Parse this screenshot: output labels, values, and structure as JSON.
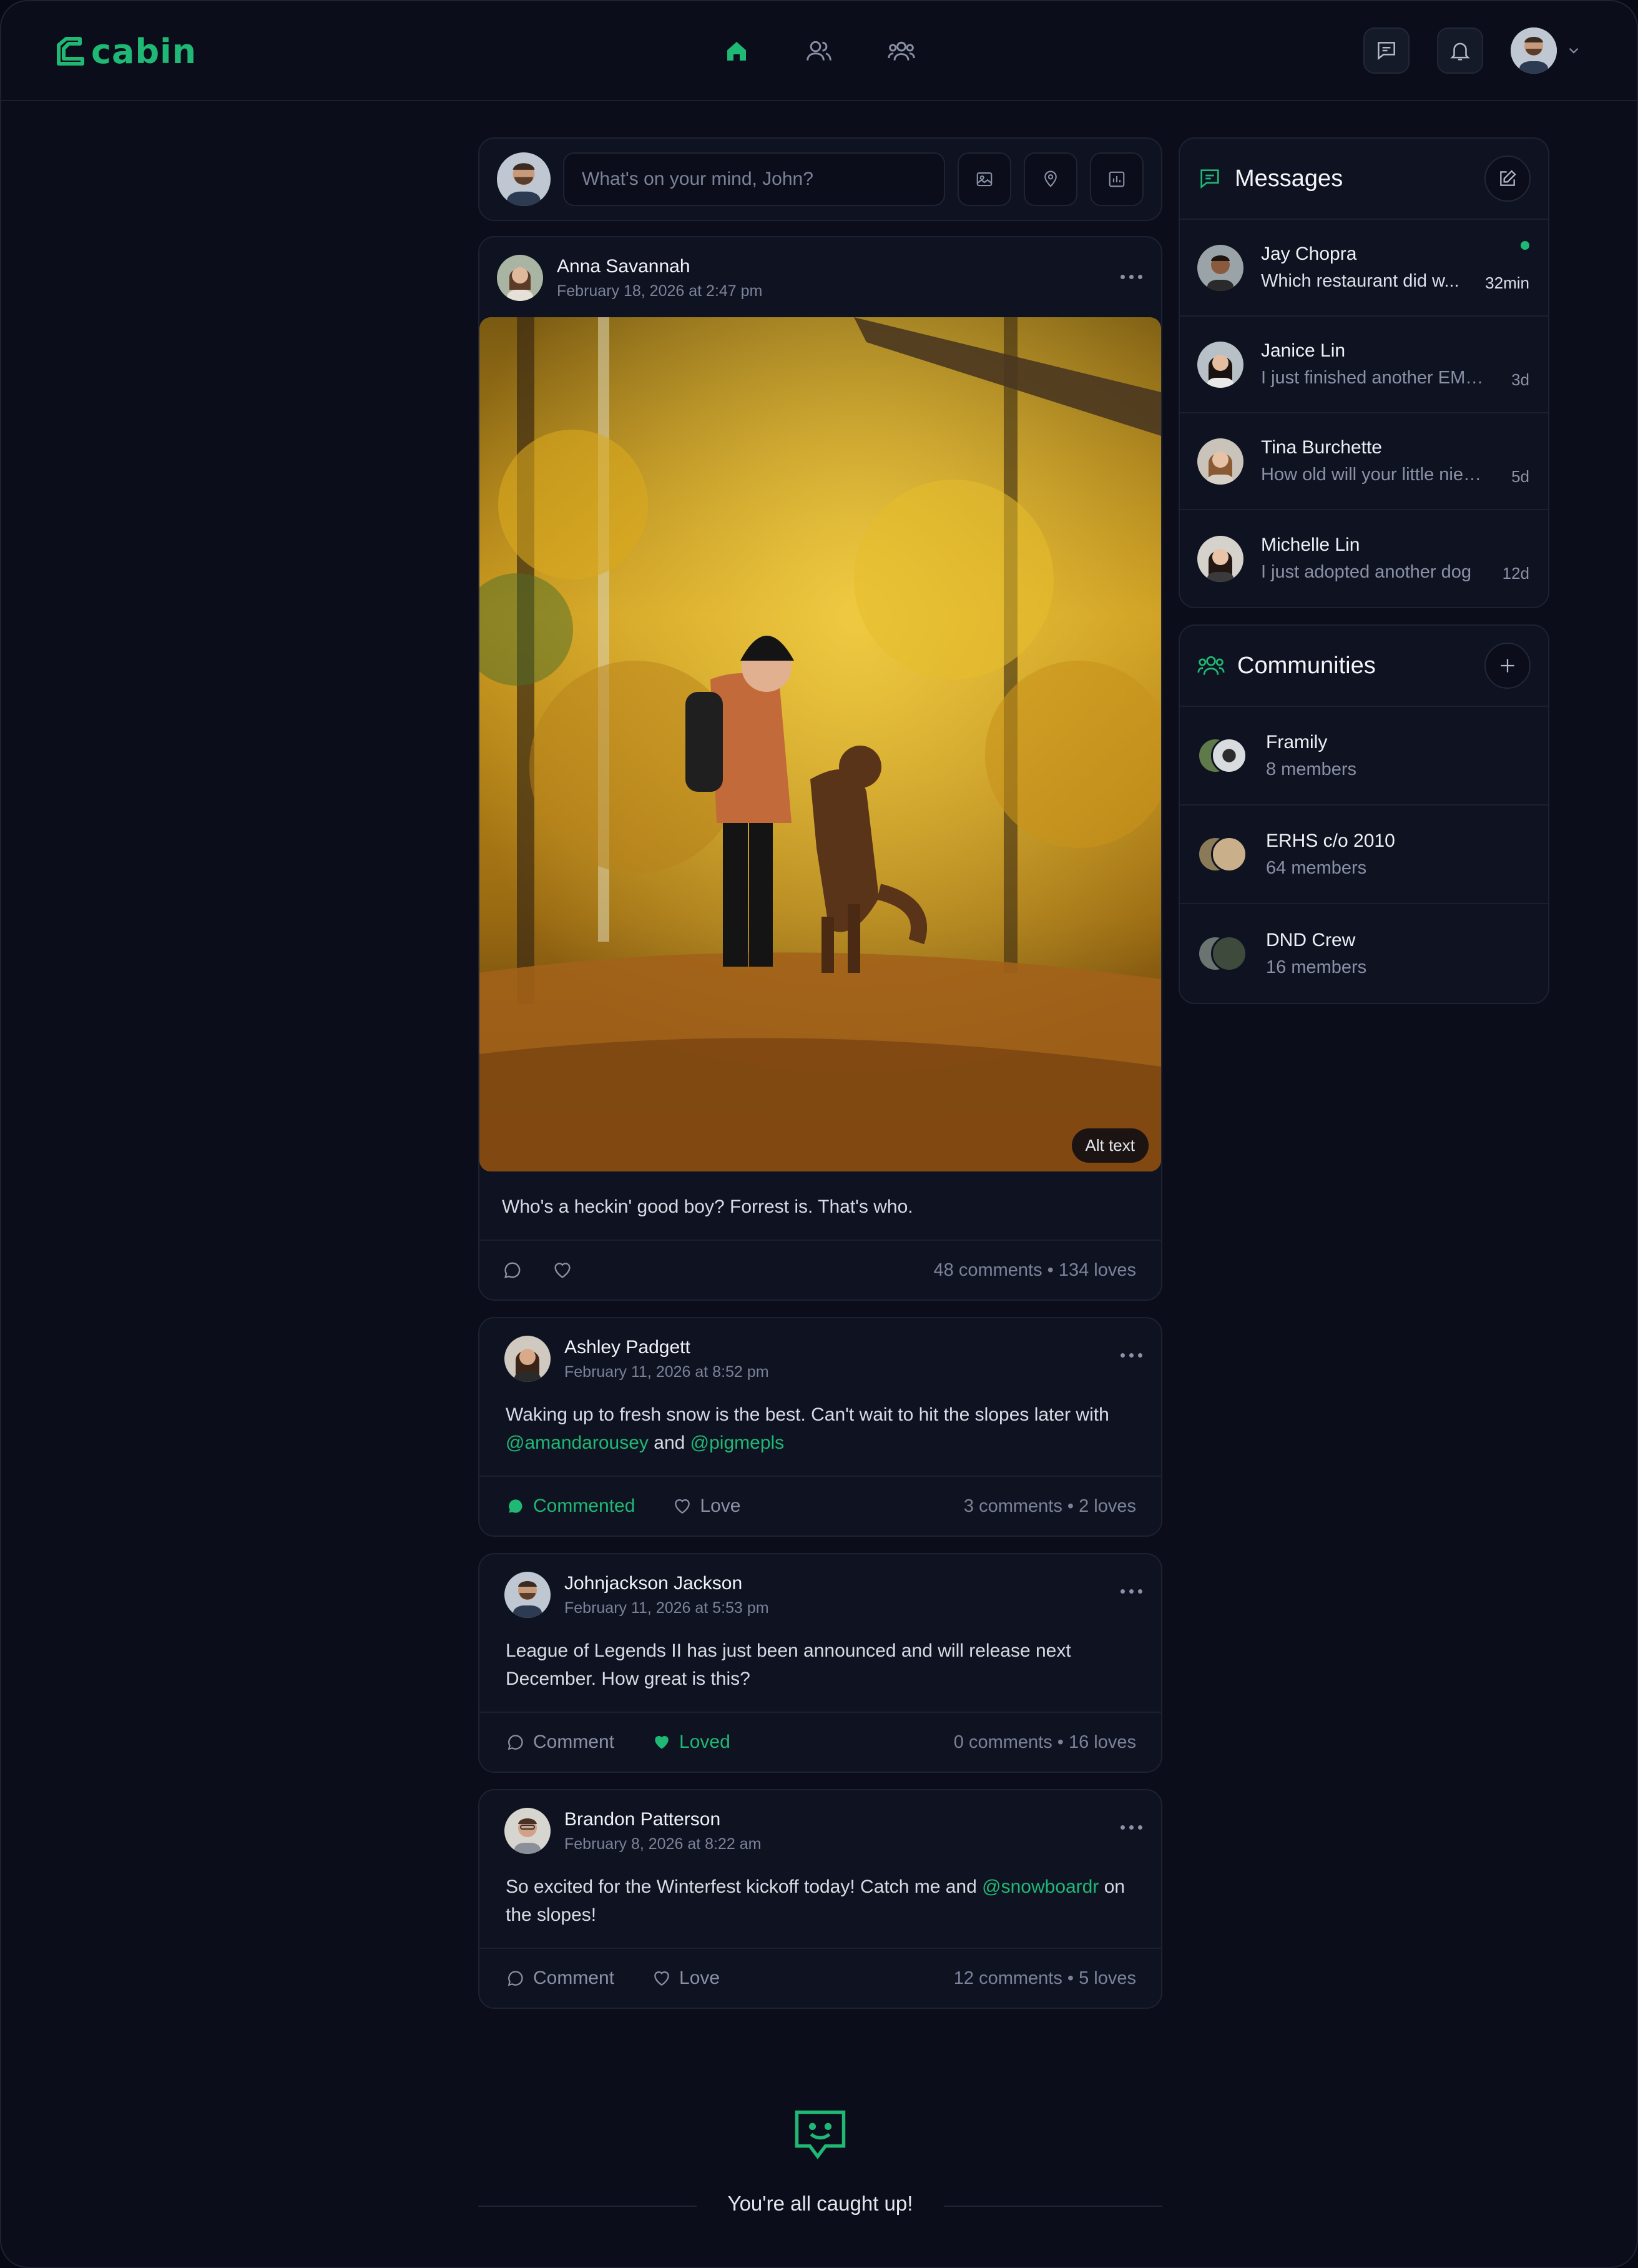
{
  "app": {
    "name": "cabin"
  },
  "composer": {
    "placeholder": "What's on your mind, John?"
  },
  "posts": [
    {
      "author": "Anna Savannah",
      "date": "February 18, 2026 at 2:47 pm",
      "alt_label": "Alt text",
      "text": "Who's a heckin' good boy? Forrest is. That's who.",
      "stats": "48 comments • 134 loves"
    },
    {
      "author": "Ashley Padgett",
      "date": "February 11, 2026 at 8:52 pm",
      "text_before": "Waking up to fresh snow is the best. Can't wait to hit the slopes later with ",
      "mention1": "@amandarousey",
      "text_mid": " and ",
      "mention2": "@pigmepls",
      "comment_label": "Commented",
      "love_label": "Love",
      "stats": "3 comments • 2 loves"
    },
    {
      "author": "Johnjackson Jackson",
      "date": "February 11, 2026 at 5:53 pm",
      "text": "League of Legends II has just been announced and will release next December. How great is this?",
      "comment_label": "Comment",
      "love_label": "Loved",
      "stats": "0 comments • 16 loves"
    },
    {
      "author": "Brandon Patterson",
      "date": "February 8, 2026 at 8:22 am",
      "text_before": "So excited for the Winterfest kickoff today! Catch me and ",
      "mention1": "@snowboardr",
      "text_after": " on the slopes!",
      "comment_label": "Comment",
      "love_label": "Love",
      "stats": "12 comments • 5 loves"
    }
  ],
  "caught_up": "You're all caught up!",
  "messages": {
    "title": "Messages",
    "items": [
      {
        "name": "Jay Chopra",
        "preview": "Which restaurant did w...",
        "time": "32min",
        "unread": true
      },
      {
        "name": "Janice Lin",
        "preview": "I just finished another EMS r...",
        "time": "3d",
        "unread": false
      },
      {
        "name": "Tina Burchette",
        "preview": "How old will your little niec...",
        "time": "5d",
        "unread": false
      },
      {
        "name": "Michelle Lin",
        "preview": "I just adopted another dog",
        "time": "12d",
        "unread": false
      }
    ]
  },
  "communities": {
    "title": "Communities",
    "items": [
      {
        "name": "Framily",
        "members": "8 members"
      },
      {
        "name": "ERHS c/o 2010",
        "members": "64 members"
      },
      {
        "name": "DND Crew",
        "members": "16 members"
      }
    ]
  },
  "colors": {
    "accent": "#1fb874",
    "background": "#0b0e1a",
    "card": "#0f1321"
  }
}
